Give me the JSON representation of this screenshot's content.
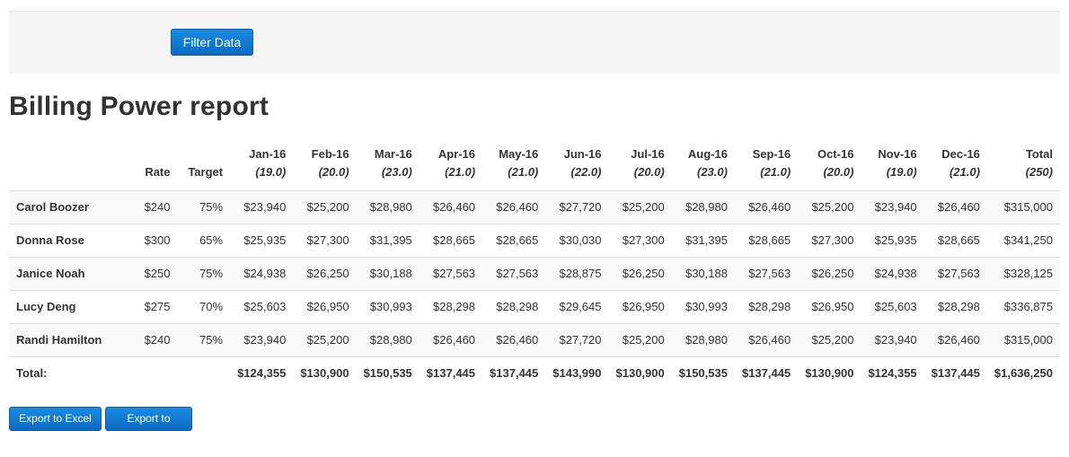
{
  "filter": {
    "button_label": "Filter Data"
  },
  "page": {
    "title": "Billing Power report"
  },
  "table": {
    "columns": {
      "rate": "Rate",
      "target": "Target",
      "months": [
        {
          "label": "Jan-16",
          "days": "(19.0)"
        },
        {
          "label": "Feb-16",
          "days": "(20.0)"
        },
        {
          "label": "Mar-16",
          "days": "(23.0)"
        },
        {
          "label": "Apr-16",
          "days": "(21.0)"
        },
        {
          "label": "May-16",
          "days": "(21.0)"
        },
        {
          "label": "Jun-16",
          "days": "(22.0)"
        },
        {
          "label": "Jul-16",
          "days": "(20.0)"
        },
        {
          "label": "Aug-16",
          "days": "(23.0)"
        },
        {
          "label": "Sep-16",
          "days": "(21.0)"
        },
        {
          "label": "Oct-16",
          "days": "(20.0)"
        },
        {
          "label": "Nov-16",
          "days": "(19.0)"
        },
        {
          "label": "Dec-16",
          "days": "(21.0)"
        }
      ],
      "total": {
        "label": "Total",
        "days": "(250)"
      }
    },
    "rows": [
      {
        "name": "Carol Boozer",
        "rate": "$240",
        "target": "75%",
        "months": [
          "$23,940",
          "$25,200",
          "$28,980",
          "$26,460",
          "$26,460",
          "$27,720",
          "$25,200",
          "$28,980",
          "$26,460",
          "$25,200",
          "$23,940",
          "$26,460"
        ],
        "total": "$315,000"
      },
      {
        "name": "Donna Rose",
        "rate": "$300",
        "target": "65%",
        "months": [
          "$25,935",
          "$27,300",
          "$31,395",
          "$28,665",
          "$28,665",
          "$30,030",
          "$27,300",
          "$31,395",
          "$28,665",
          "$27,300",
          "$25,935",
          "$28,665"
        ],
        "total": "$341,250"
      },
      {
        "name": "Janice Noah",
        "rate": "$250",
        "target": "75%",
        "months": [
          "$24,938",
          "$26,250",
          "$30,188",
          "$27,563",
          "$27,563",
          "$28,875",
          "$26,250",
          "$30,188",
          "$27,563",
          "$26,250",
          "$24,938",
          "$27,563"
        ],
        "total": "$328,125"
      },
      {
        "name": "Lucy Deng",
        "rate": "$275",
        "target": "70%",
        "months": [
          "$25,603",
          "$26,950",
          "$30,993",
          "$28,298",
          "$28,298",
          "$29,645",
          "$26,950",
          "$30,993",
          "$28,298",
          "$26,950",
          "$25,603",
          "$28,298"
        ],
        "total": "$336,875"
      },
      {
        "name": "Randi Hamilton",
        "rate": "$240",
        "target": "75%",
        "months": [
          "$23,940",
          "$25,200",
          "$28,980",
          "$26,460",
          "$26,460",
          "$27,720",
          "$25,200",
          "$28,980",
          "$26,460",
          "$25,200",
          "$23,940",
          "$26,460"
        ],
        "total": "$315,000"
      }
    ],
    "totals": {
      "label": "Total:",
      "months": [
        "$124,355",
        "$130,900",
        "$150,535",
        "$137,445",
        "$137,445",
        "$143,990",
        "$130,900",
        "$150,535",
        "$137,445",
        "$130,900",
        "$124,355",
        "$137,445"
      ],
      "total": "$1,636,250"
    }
  },
  "export": {
    "excel_label": "Export to Excel",
    "pdf_label": "Export to PDF"
  },
  "colors": {
    "button": "#0a6cc2",
    "filter_bar_bg": "#f5f5f5",
    "stripe": "#f9f9f9"
  }
}
